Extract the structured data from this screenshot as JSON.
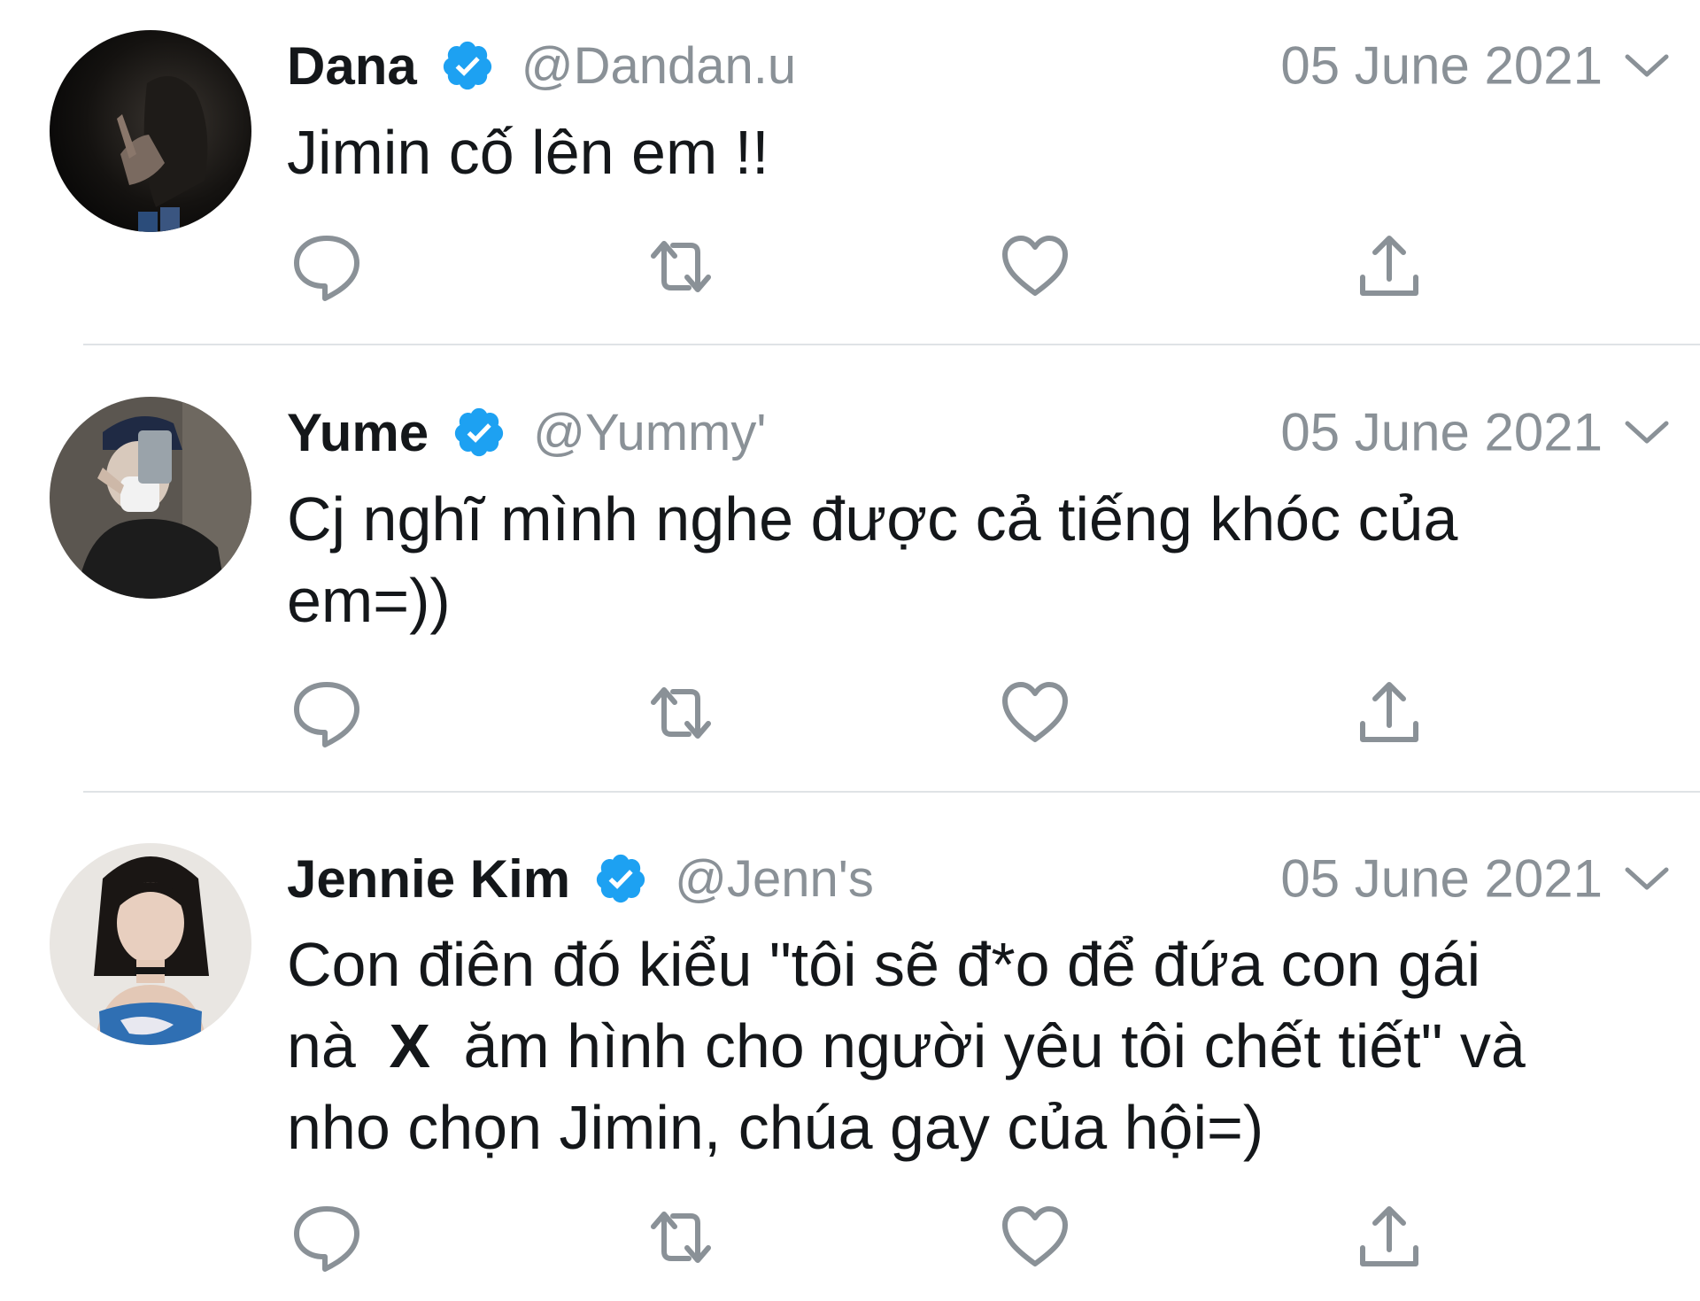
{
  "colors": {
    "text": "#14171a",
    "muted": "#8a9197",
    "verified": "#1da1f2",
    "divider": "#dfe3e6",
    "icon": "#8a9197"
  },
  "tweets": [
    {
      "name": "Dana",
      "handle": "@Dandan.u",
      "date": "05 June 2021",
      "text_lines": [
        "Jimin cố lên em !!"
      ],
      "avatar": "dark-photo-avatar",
      "icons": {
        "reply": "reply-icon",
        "retweet": "retweet-icon",
        "like": "heart-icon",
        "share": "share-icon",
        "more": "chevron-down-icon",
        "verified": "verified-badge-icon"
      }
    },
    {
      "name": "Yume",
      "handle": "@Yummy'",
      "date": "05 June 2021",
      "text_lines": [
        "Cj nghĩ mình nghe được cả tiếng khóc của",
        "em=))"
      ],
      "avatar": "selfie-photo-avatar"
    },
    {
      "name": "Jennie Kim",
      "handle": "@Jenn's",
      "date": "05 June 2021",
      "text_lines": [
        "Con điên đó kiểu \"tôi sẽ đ*o để đứa con gái",
        "nà",
        "X",
        "ăm hình cho người yêu tôi chết tiết\" và",
        "nho chọn Jimin, chúa gay của hội=)"
      ],
      "avatar": "portrait-photo-avatar"
    }
  ]
}
